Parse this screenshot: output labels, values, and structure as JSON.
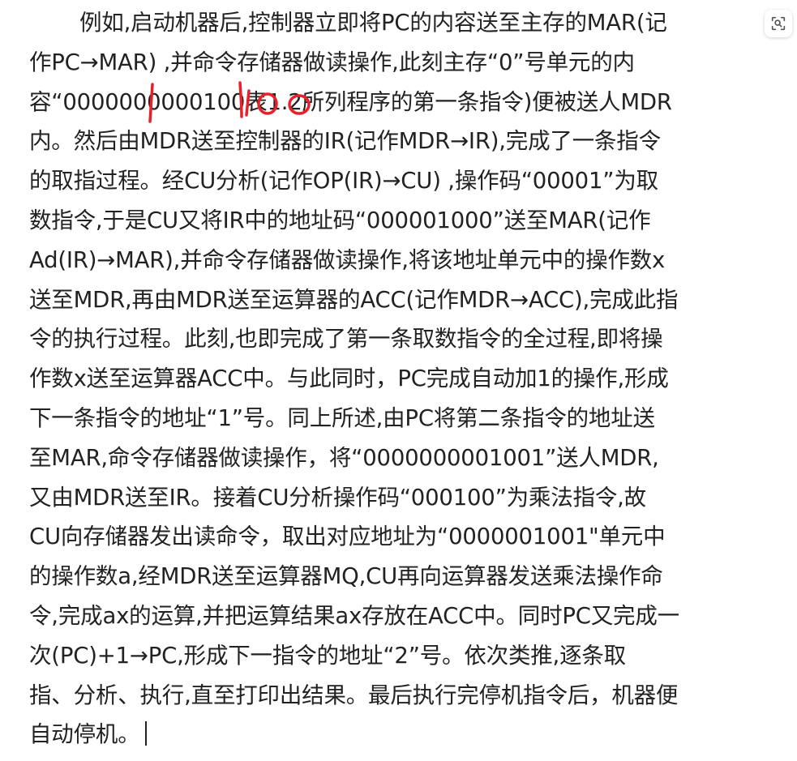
{
  "document": {
    "lines": [
      "例如,启动机器后,控制器立即将PC的内容送至主存的MAR(记",
      "作PC→MAR) ,并命令存储器做读操作,此刻主存“0”号单元的内",
      "容“0000000000100表1.2所列程序的第一条指令)便被送人MDR",
      "内。然后由MDR送至控制器的IR(记作MDR→IR),完成了一条指令",
      "的取指过程。经CU分析(记作OP(IR)→CU) ,操作码“00001”为取",
      "数指令,于是CU又将IR中的地址码“000001000”送至MAR(记作",
      "Ad(IR)→MAR),并命令存储器做读操作,将该地址单元中的操作数x",
      "送至MDR,再由MDR送至运算器的ACC(记作MDR→ACC),完成此指",
      "令的执行过程。此刻,也即完成了第一条取数指令的全过程,即将操",
      "作数x送至运算器ACC中。与此同时，PC完成自动加1的操作,形成",
      "下一条指令的地址“1”号。同上所述,由PC将第二条指令的地址送",
      "至MAR,命令存储器做读操作，将“0000000001001”送人MDR,",
      "又由MDR送至IR。接着CU分析操作码“000100”为乘法指令,故",
      "CU向存储器发出读命令，取出对应地址为“0000001001\"单元中",
      "的操作数a,经MDR送至运算器MQ,CU再向运算器发送乘法操作命",
      "令,完成ax的运算,并把运算结果ax存放在ACC中。同时PC又完成一",
      "次(PC)+1→PC,形成下一指令的地址“2”号。依次类推,逐条取",
      "指、分析、执行,直至打印出结果。最后执行完停机指令后，机器便",
      "自动停机。"
    ]
  },
  "toolbar": {
    "scan_icon": "scan-icon"
  },
  "colors": {
    "text": "#222222",
    "handwriting": "#e8202a",
    "background": "#ffffff",
    "icon": "#555555"
  }
}
